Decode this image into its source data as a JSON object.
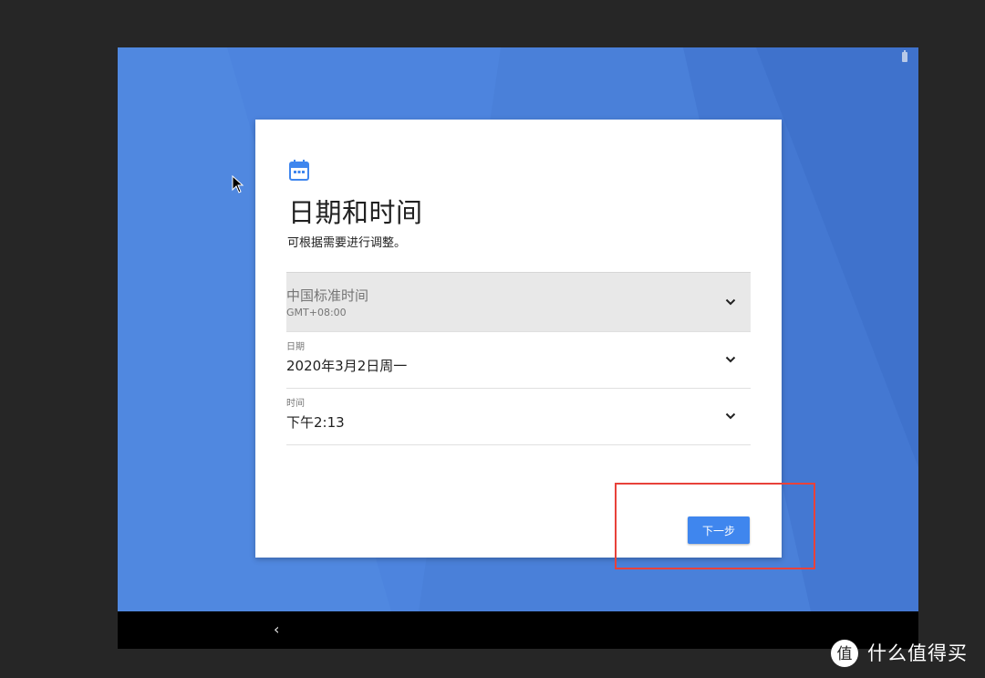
{
  "setup": {
    "title": "日期和时间",
    "subtitle": "可根据需要进行调整。",
    "timezone": {
      "name": "中国标准时间",
      "offset": "GMT+08:00"
    },
    "date": {
      "label": "日期",
      "value": "2020年3月2日周一"
    },
    "time": {
      "label": "时间",
      "value": "下午2:13"
    },
    "next_label": "下一步"
  },
  "navbar": {
    "back_glyph": "‹"
  },
  "watermark": {
    "text": "什么值得买"
  },
  "colors": {
    "wallpaper": "#4a80d9",
    "accent": "#3f86ee",
    "highlight": "#e8423a"
  },
  "icons": [
    "calendar-icon",
    "chevron-down-icon",
    "back-icon",
    "cursor-icon",
    "battery-icon"
  ]
}
